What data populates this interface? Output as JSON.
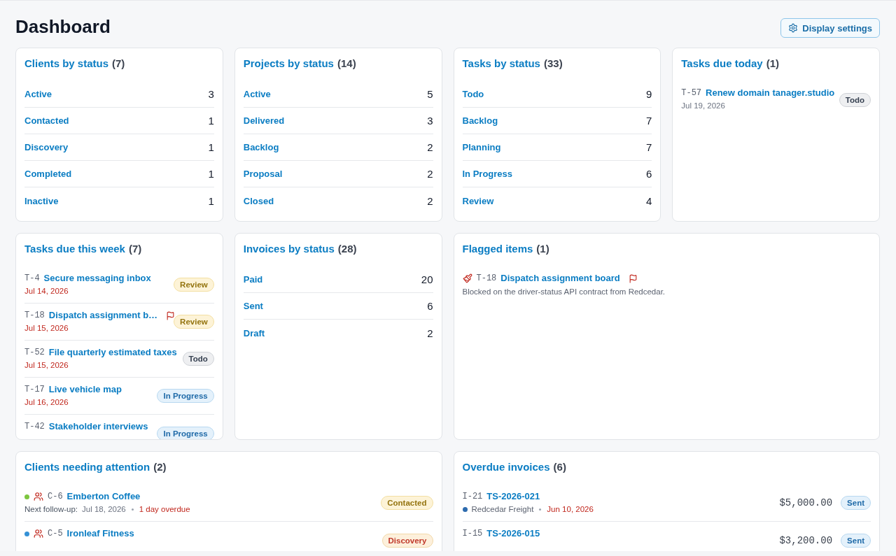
{
  "page": {
    "title": "Dashboard",
    "settings_button": "Display settings"
  },
  "cards": [
    {
      "kind": "status",
      "title": "Clients by status",
      "count": "(7)",
      "rows": [
        {
          "label": "Active",
          "count": "3"
        },
        {
          "label": "Contacted",
          "count": "1"
        },
        {
          "label": "Discovery",
          "count": "1"
        },
        {
          "label": "Completed",
          "count": "1"
        },
        {
          "label": "Inactive",
          "count": "1"
        }
      ]
    },
    {
      "kind": "status",
      "title": "Projects by status",
      "count": "(14)",
      "rows": [
        {
          "label": "Active",
          "count": "5"
        },
        {
          "label": "Delivered",
          "count": "3"
        },
        {
          "label": "Backlog",
          "count": "2"
        },
        {
          "label": "Proposal",
          "count": "2"
        },
        {
          "label": "Closed",
          "count": "2"
        }
      ]
    },
    {
      "kind": "status",
      "title": "Tasks by status",
      "count": "(33)",
      "rows": [
        {
          "label": "Todo",
          "count": "9"
        },
        {
          "label": "Backlog",
          "count": "7"
        },
        {
          "label": "Planning",
          "count": "7"
        },
        {
          "label": "In Progress",
          "count": "6"
        },
        {
          "label": "Review",
          "count": "4"
        }
      ]
    },
    {
      "kind": "tasks",
      "title": "Tasks due today",
      "count": "(1)",
      "items": [
        {
          "id": "T-57",
          "title": "Renew domain tanager.studio",
          "due": "Jul 19, 2026",
          "overdue": false,
          "flagged": false,
          "status": {
            "label": "Todo",
            "kind": "neutral"
          }
        }
      ]
    },
    {
      "kind": "tasks",
      "title": "Tasks due this week",
      "count": "(7)",
      "items": [
        {
          "id": "T-4",
          "title": "Secure messaging inbox",
          "due": "Jul 14, 2026",
          "overdue": true,
          "flagged": false,
          "status": {
            "label": "Review",
            "kind": "warning"
          }
        },
        {
          "id": "T-18",
          "title": "Dispatch assignment b…",
          "due": "Jul 15, 2026",
          "overdue": true,
          "flagged": true,
          "status": {
            "label": "Review",
            "kind": "warning"
          }
        },
        {
          "id": "T-52",
          "title": "File quarterly estimated taxes",
          "due": "Jul 15, 2026",
          "overdue": true,
          "flagged": false,
          "status": {
            "label": "Todo",
            "kind": "neutral"
          }
        },
        {
          "id": "T-17",
          "title": "Live vehicle map",
          "due": "Jul 16, 2026",
          "overdue": true,
          "flagged": false,
          "status": {
            "label": "In Progress",
            "kind": "info"
          }
        },
        {
          "id": "T-42",
          "title": "Stakeholder interviews",
          "flagged": false,
          "status": {
            "label": "In Progress",
            "kind": "info"
          }
        }
      ]
    },
    {
      "kind": "status",
      "title": "Invoices by status",
      "count": "(28)",
      "rows": [
        {
          "label": "Paid",
          "count": "20"
        },
        {
          "label": "Sent",
          "count": "6"
        },
        {
          "label": "Draft",
          "count": "2"
        }
      ]
    },
    {
      "kind": "flagged",
      "title": "Flagged items",
      "count": "(1)",
      "items": [
        {
          "id": "T-18",
          "title": "Dispatch assignment board",
          "flagged": true,
          "note": "Blocked on the driver-status API contract from Redcedar."
        }
      ]
    },
    {
      "kind": "clients",
      "title": "Clients needing attention",
      "count": "(2)",
      "items": [
        {
          "color": "#7dc63f",
          "id": "C-6",
          "name": "Emberton Coffee",
          "follow_up_label": "Next follow-up:",
          "follow_up": "Jul 18, 2026",
          "overdue_note": "1 day overdue",
          "status": {
            "label": "Contacted",
            "kind": "warning"
          }
        },
        {
          "color": "#3591d6",
          "id": "C-5",
          "name": "Ironleaf Fitness",
          "status": {
            "label": "Discovery",
            "kind": "alert"
          }
        }
      ]
    },
    {
      "kind": "invoices",
      "title": "Overdue invoices",
      "count": "(6)",
      "items": [
        {
          "id": "I-21",
          "number": "TS-2026-021",
          "color": "#2d6bae",
          "client": "Redcedar Freight",
          "due": "Jun 10, 2026",
          "overdue": true,
          "amount": "$5,000.00",
          "status": {
            "label": "Sent",
            "kind": "info"
          }
        },
        {
          "id": "I-15",
          "number": "TS-2026-015",
          "amount": "$3,200.00",
          "status": {
            "label": "Sent",
            "kind": "info"
          }
        }
      ]
    }
  ]
}
